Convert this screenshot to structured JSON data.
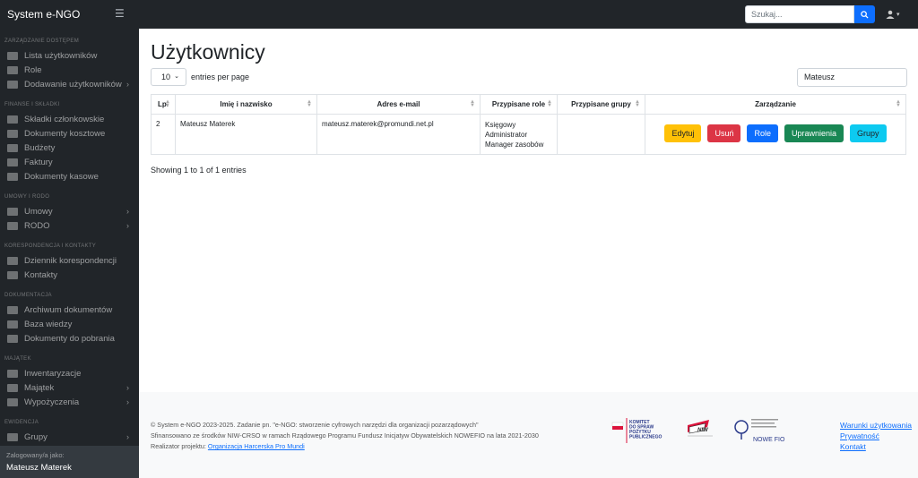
{
  "app": {
    "brand": "System e-NGO",
    "menu_icon": "hamburger-icon"
  },
  "topbar": {
    "search_placeholder": "Szukaj...",
    "search_icon": "search-icon",
    "user_icon": "user-icon"
  },
  "sidebar": {
    "sections": [
      {
        "heading": "ZARZĄDZANIE DOSTĘPEM",
        "items": [
          {
            "label": "Lista użytkowników",
            "icon": "users-icon"
          },
          {
            "label": "Role",
            "icon": "id-card-icon"
          },
          {
            "label": "Dodawanie użytkowników",
            "icon": "user-plus-icon",
            "has_children": true
          }
        ]
      },
      {
        "heading": "FINANSE I SKŁADKI",
        "items": [
          {
            "label": "Składki członkowskie",
            "icon": "coins-icon"
          },
          {
            "label": "Dokumenty kosztowe",
            "icon": "file-invoice-icon"
          },
          {
            "label": "Budżety",
            "icon": "piggy-bank-icon"
          },
          {
            "label": "Faktury",
            "icon": "file-icon"
          },
          {
            "label": "Dokumenty kasowe",
            "icon": "cash-icon"
          }
        ]
      },
      {
        "heading": "UMOWY I RODO",
        "items": [
          {
            "label": "Umowy",
            "icon": "file-contract-icon",
            "has_children": true
          },
          {
            "label": "RODO",
            "icon": "shield-icon",
            "has_children": true
          }
        ]
      },
      {
        "heading": "KORESPONDENCJA I KONTAKTY",
        "items": [
          {
            "label": "Dziennik korespondencji",
            "icon": "book-icon"
          },
          {
            "label": "Kontakty",
            "icon": "address-book-icon"
          }
        ]
      },
      {
        "heading": "DOKUMENTACJA",
        "items": [
          {
            "label": "Archiwum dokumentów",
            "icon": "archive-icon"
          },
          {
            "label": "Baza wiedzy",
            "icon": "book-open-icon"
          },
          {
            "label": "Dokumenty do pobrania",
            "icon": "download-icon"
          }
        ]
      },
      {
        "heading": "MAJĄTEK",
        "items": [
          {
            "label": "Inwentaryzacje",
            "icon": "clipboard-icon"
          },
          {
            "label": "Majątek",
            "icon": "tools-icon",
            "has_children": true
          },
          {
            "label": "Wypożyczenia",
            "icon": "handshake-icon",
            "has_children": true
          }
        ]
      },
      {
        "heading": "EWIDENCJA",
        "items": [
          {
            "label": "Grupy",
            "icon": "group-icon",
            "has_children": true
          }
        ]
      }
    ],
    "footer_label": "Zalogowany/a jako:",
    "footer_user": "Mateusz Materek"
  },
  "main": {
    "title": "Użytkownicy",
    "length_value": "10",
    "length_label": "entries per page",
    "filter_value": "Mateusz",
    "columns": [
      "Lp.",
      "Imię i nazwisko",
      "Adres e-mail",
      "Przypisane role",
      "Przypisane grupy",
      "Zarządzanie"
    ],
    "rows": [
      {
        "lp": "2",
        "name": "Mateusz Materek",
        "email": "mateusz.materek@promundi.net.pl",
        "roles": [
          "Księgowy",
          "Administrator",
          "Manager zasobów"
        ],
        "groups": ""
      }
    ],
    "actions": [
      {
        "label": "Edytuj",
        "color": "#ffc107",
        "text_color": "#212529"
      },
      {
        "label": "Usuń",
        "color": "#dc3545",
        "text_color": "#ffffff"
      },
      {
        "label": "Role",
        "color": "#0d6efd",
        "text_color": "#ffffff"
      },
      {
        "label": "Uprawnienia",
        "color": "#198754",
        "text_color": "#ffffff"
      },
      {
        "label": "Grupy",
        "color": "#0dcaf0",
        "text_color": "#212529"
      }
    ],
    "info": "Showing 1 to 1 of 1 entries"
  },
  "footer": {
    "line1": "© System e-NGO 2023-2025. Zadanie pn. \"e-NGO: stworzenie cyfrowych narzędzi dla organizacji pozarządowych\"",
    "line2": "Sfinansowano ze środków NIW-CRSO w ramach Rządowego Programu Fundusz Inicjatyw Obywatelskich NOWEFIO na lata 2021-2030",
    "line3_prefix": "Realizator projektu: ",
    "line3_link": "Organizacja Harcerska Pro Mundi",
    "logo1_text": "KOMITET DO SPRAW POŻYTKU PUBLICZNEGO",
    "logo2_text": "NIW",
    "logo3_text": "NOWE FIO",
    "links": [
      "Warunki użytkowania",
      "Prywatność",
      "Kontakt"
    ]
  }
}
